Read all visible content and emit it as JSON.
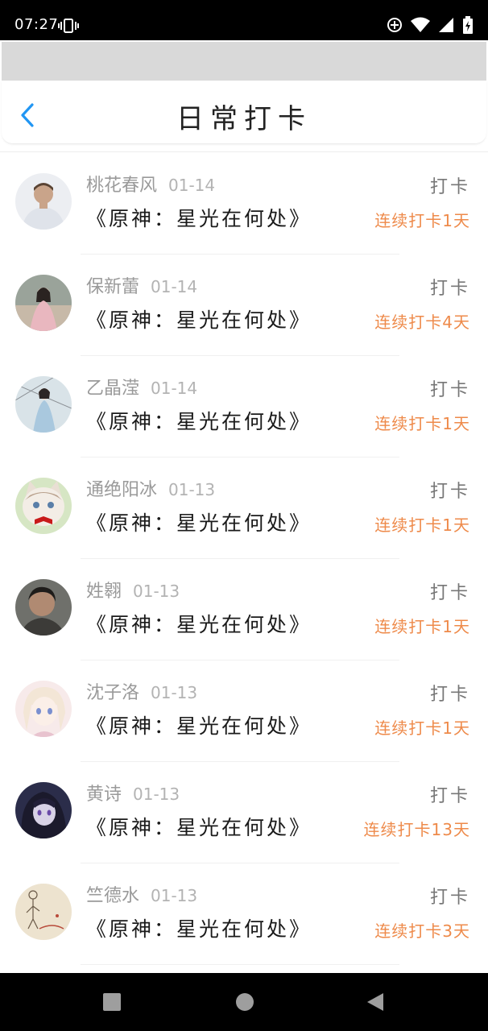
{
  "status_bar": {
    "time": "07:27",
    "icons": [
      "vibrate-icon",
      "data-saver-icon",
      "wifi-icon",
      "cellular-icon",
      "battery-icon"
    ]
  },
  "header": {
    "back_icon": "chevron-left-icon",
    "title": "日常打卡",
    "accent_color": "#2196f3"
  },
  "entries": [
    {
      "name": "桃花春风",
      "date": "01-14",
      "book": "《原神：星光在何处》",
      "action": "打卡",
      "streak": "连续打卡1天"
    },
    {
      "name": "保新蕾",
      "date": "01-14",
      "book": "《原神：星光在何处》",
      "action": "打卡",
      "streak": "连续打卡4天"
    },
    {
      "name": "乙晶滢",
      "date": "01-14",
      "book": "《原神：星光在何处》",
      "action": "打卡",
      "streak": "连续打卡1天"
    },
    {
      "name": "通绝阳冰",
      "date": "01-13",
      "book": "《原神：星光在何处》",
      "action": "打卡",
      "streak": "连续打卡1天"
    },
    {
      "name": "姓翱",
      "date": "01-13",
      "book": "《原神：星光在何处》",
      "action": "打卡",
      "streak": "连续打卡1天"
    },
    {
      "name": "沈子洛",
      "date": "01-13",
      "book": "《原神：星光在何处》",
      "action": "打卡",
      "streak": "连续打卡1天"
    },
    {
      "name": "黄诗",
      "date": "01-13",
      "book": "《原神：星光在何处》",
      "action": "打卡",
      "streak": "连续打卡13天"
    },
    {
      "name": "竺德水",
      "date": "01-13",
      "book": "《原神：星光在何处》",
      "action": "打卡",
      "streak": "连续打卡3天"
    }
  ],
  "streak_color": "#ee8a4a",
  "nav_bar": {
    "icons": [
      "recents-square-icon",
      "home-circle-icon",
      "back-triangle-icon"
    ]
  }
}
